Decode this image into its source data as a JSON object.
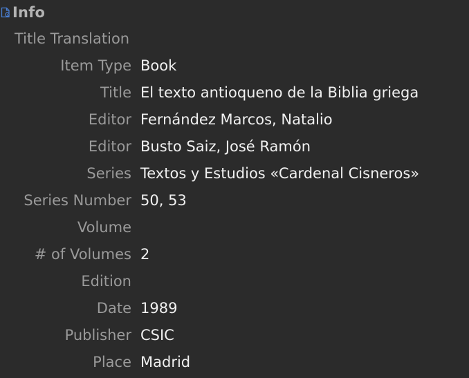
{
  "section": {
    "title": "Info",
    "icon": "document-info-icon"
  },
  "fields": [
    {
      "label": "Title Translation",
      "value": ""
    },
    {
      "label": "Item Type",
      "value": "Book"
    },
    {
      "label": "Title",
      "value": "El texto antioqueno de la Biblia griega"
    },
    {
      "label": "Editor",
      "value": "Fernández Marcos, Natalio"
    },
    {
      "label": "Editor",
      "value": "Busto Saiz, José Ramón"
    },
    {
      "label": "Series",
      "value": "Textos y Estudios «Cardenal Cisneros»"
    },
    {
      "label": "Series Number",
      "value": "50, 53"
    },
    {
      "label": "Volume",
      "value": ""
    },
    {
      "label": "# of Volumes",
      "value": "2"
    },
    {
      "label": "Edition",
      "value": ""
    },
    {
      "label": "Date",
      "value": "1989"
    },
    {
      "label": "Publisher",
      "value": "CSIC"
    },
    {
      "label": "Place",
      "value": "Madrid"
    }
  ],
  "colors": {
    "background": "#2b2b2b",
    "label": "#9a9a9a",
    "value": "#f0f0f0",
    "icon": "#4a7fd4"
  }
}
